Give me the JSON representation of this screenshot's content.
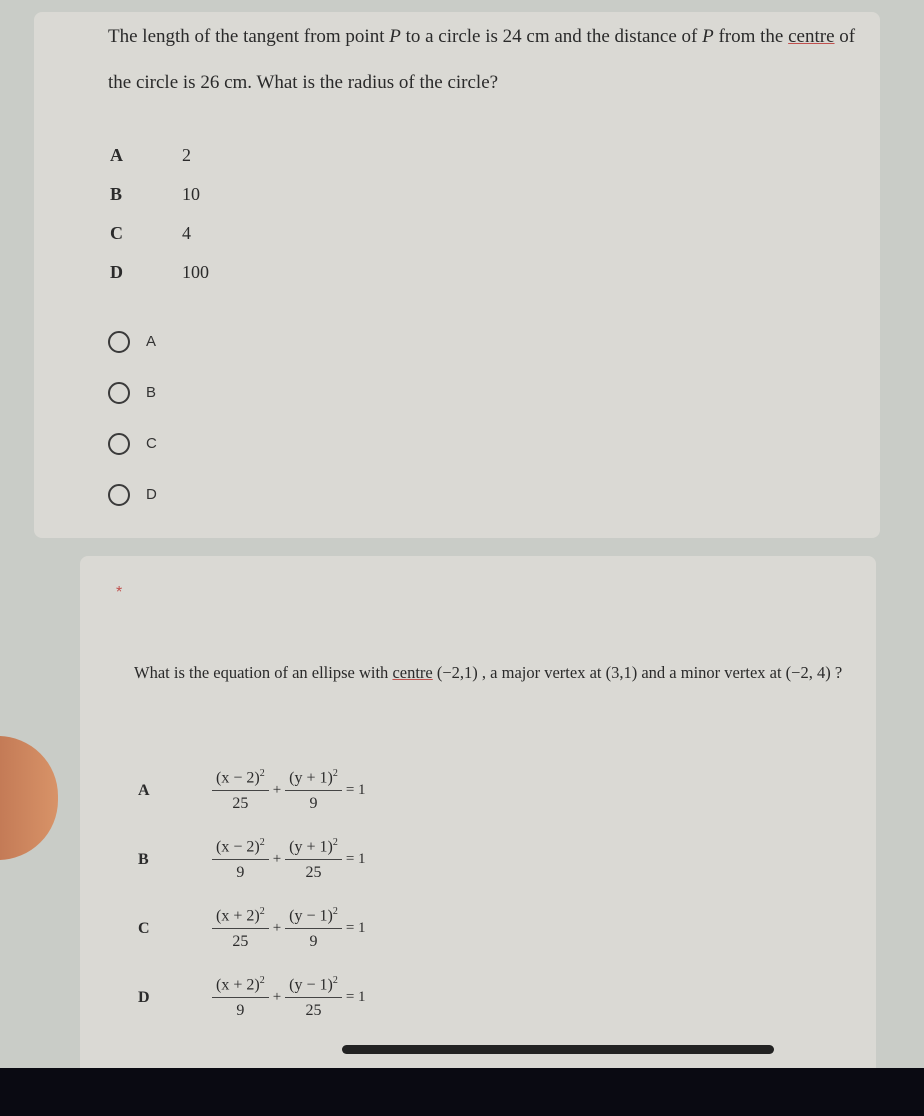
{
  "question1": {
    "text_parts": [
      "The length of the tangent from point ",
      "P",
      " to a circle is 24 cm and the distance of ",
      "P",
      " from the ",
      "centre",
      " of the circle is 26 cm. What is the radius of the circle?"
    ],
    "options": [
      {
        "letter": "A",
        "value": "2"
      },
      {
        "letter": "B",
        "value": "10"
      },
      {
        "letter": "C",
        "value": "4"
      },
      {
        "letter": "D",
        "value": "100"
      }
    ],
    "radio_choices": [
      "A",
      "B",
      "C",
      "D"
    ]
  },
  "question2": {
    "required_marker": "*",
    "text_parts": [
      "What is the equation of an ellipse with ",
      "centre",
      " (−2,1) ,  a major vertex at  (3,1)  and a minor vertex at  (−2, 4) ?"
    ],
    "options": [
      {
        "letter": "A",
        "num1": "(x − 2)",
        "den1": "25",
        "num2": "(y + 1)",
        "den2": "9"
      },
      {
        "letter": "B",
        "num1": "(x − 2)",
        "den1": "9",
        "num2": "(y + 1)",
        "den2": "25"
      },
      {
        "letter": "C",
        "num1": "(x + 2)",
        "den1": "25",
        "num2": "(y − 1)",
        "den2": "9"
      },
      {
        "letter": "D",
        "num1": "(x + 2)",
        "den1": "9",
        "num2": "(y − 1)",
        "den2": "25"
      }
    ],
    "exponent": "2",
    "plus": "+",
    "equals": "= 1"
  },
  "colors": {
    "required": "#c0504d",
    "card": "#dad9d4",
    "background": "#c9ccc7"
  }
}
